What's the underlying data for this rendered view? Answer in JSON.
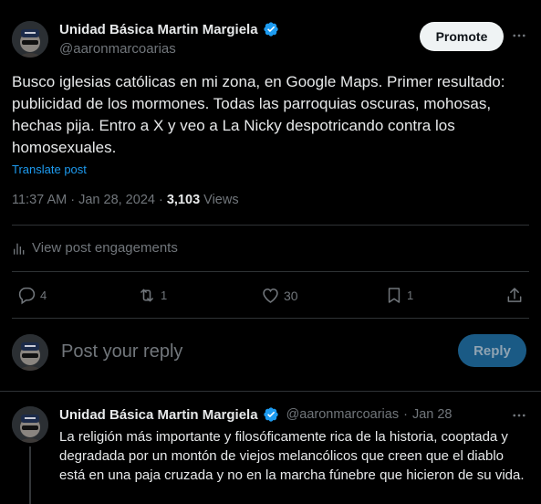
{
  "post": {
    "author_name": "Unidad Básica Martin Margiela",
    "author_handle": "@aaronmarcoarias",
    "promote_label": "Promote",
    "text": "Busco iglesias católicas en mi zona, en Google Maps. Primer resultado: publicidad de los mormones. Todas las parroquias oscuras, mohosas, hechas pija. Entro a X y veo a La Nicky despotricando contra los homosexuales.",
    "translate_label": "Translate post",
    "time": "11:37 AM",
    "date": "Jan 28, 2024",
    "views_count": "3,103",
    "views_label": "Views",
    "engagements_label": "View post engagements",
    "actions": {
      "replies": "4",
      "reposts": "1",
      "likes": "30",
      "bookmarks": "1"
    }
  },
  "composer": {
    "placeholder": "Post your reply",
    "reply_label": "Reply"
  },
  "reply_tweet": {
    "author_name": "Unidad Básica Martin Margiela",
    "author_handle": "@aaronmarcoarias",
    "date": "Jan 28",
    "text": "La religión más importante y filosóficamente rica de la historia, cooptada y degradada por un montón de viejos melancólicos que creen que el diablo está en una paja cruzada y no en la marcha fúnebre que hicieron de su vida."
  },
  "icons": {
    "verified": "verified-badge-icon",
    "more": "more-dots-icon",
    "analytics": "analytics-bars-icon",
    "reply": "reply-bubble-icon",
    "repost": "repost-arrows-icon",
    "like": "heart-icon",
    "bookmark": "bookmark-icon",
    "share": "share-upload-icon"
  },
  "colors": {
    "accent": "#1d9bf0",
    "secondary_text": "#71767b",
    "divider": "#2f3336",
    "reply_button_disabled": "#1a5a85"
  }
}
